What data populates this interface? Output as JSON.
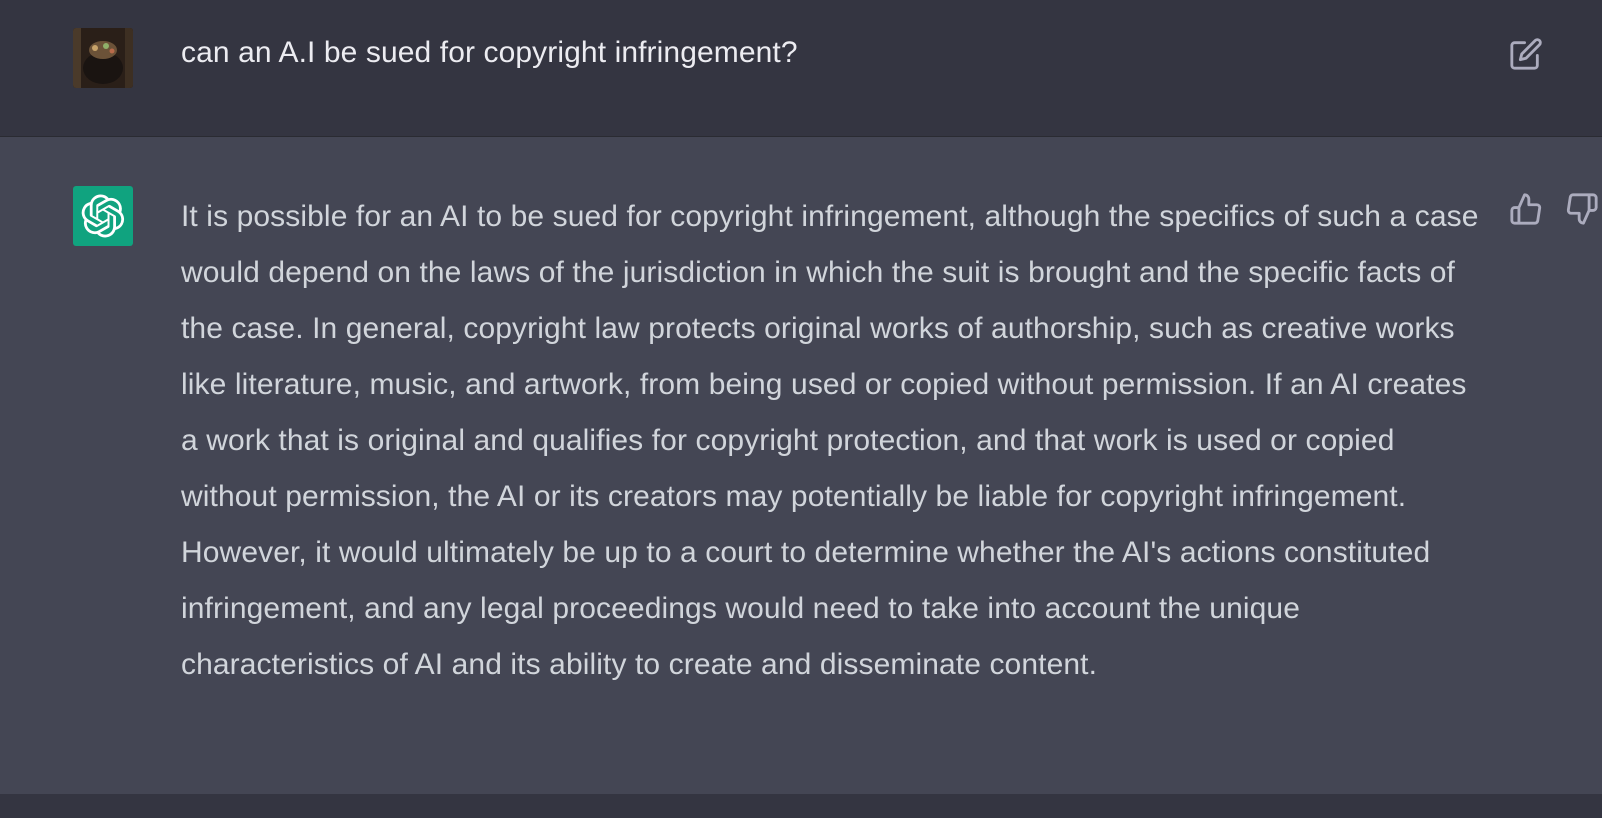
{
  "conversation": {
    "user_message": {
      "text": "can an A.I be sued for copyright infringement?"
    },
    "assistant_message": {
      "text": "It is possible for an AI to be sued for copyright infringement, although the specifics of such a case would depend on the laws of the jurisdiction in which the suit is brought and the specific facts of the case. In general, copyright law protects original works of authorship, such as creative works like literature, music, and artwork, from being used or copied without permission. If an AI creates a work that is original and qualifies for copyright protection, and that work is used or copied without permission, the AI or its creators may potentially be liable for copyright infringement. However, it would ultimately be up to a court to determine whether the AI's actions constituted infringement, and any legal proceedings would need to take into account the unique characteristics of AI and its ability to create and disseminate content."
    }
  },
  "icons": {
    "edit": "edit-icon",
    "thumbs_up": "thumbs-up-icon",
    "thumbs_down": "thumbs-down-icon",
    "assistant_logo": "openai-logo-icon"
  },
  "colors": {
    "user_row_bg": "#343541",
    "assistant_row_bg": "#444654",
    "assistant_logo_bg": "#10a37f",
    "user_text": "#ececf1",
    "assistant_text": "#d1d5db",
    "icon_color": "#acacbe"
  }
}
